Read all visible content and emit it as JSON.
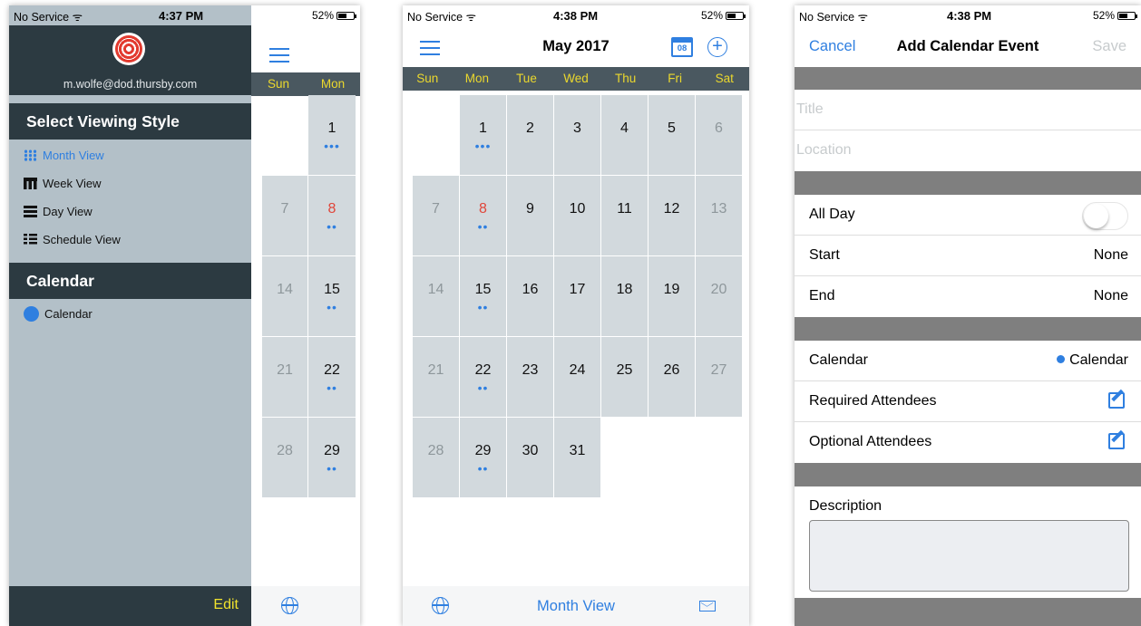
{
  "phone1": {
    "status": {
      "carrier": "No Service",
      "time": "4:37 PM",
      "battery": "52%"
    },
    "email": "m.wolfe@dod.thursby.com",
    "viewing_section": "Select Viewing Style",
    "views": [
      {
        "label": "Month View",
        "icon": "grid-icon",
        "active": true
      },
      {
        "label": "Week View",
        "icon": "week-icon",
        "active": false
      },
      {
        "label": "Day View",
        "icon": "day-icon",
        "active": false
      },
      {
        "label": "Schedule View",
        "icon": "schedule-icon",
        "active": false
      }
    ],
    "calendar_section": "Calendar",
    "calendar_item": "Calendar",
    "edit": "Edit",
    "days": [
      "Sun",
      "Mon"
    ],
    "cells": [
      {
        "sun": "",
        "mon": "1",
        "mon_dots": "•••"
      },
      {
        "sun": "7",
        "mon": "8",
        "mon_dots": "••"
      },
      {
        "sun": "14",
        "mon": "15",
        "mon_dots": "••"
      },
      {
        "sun": "21",
        "mon": "22",
        "mon_dots": "••"
      },
      {
        "sun": "28",
        "mon": "29",
        "mon_dots": "••"
      }
    ]
  },
  "phone2": {
    "status": {
      "carrier": "No Service",
      "time": "4:38 PM",
      "battery": "52%"
    },
    "title": "May 2017",
    "cal_icon_day": "08",
    "days": [
      "Sun",
      "Mon",
      "Tue",
      "Wed",
      "Thu",
      "Fri",
      "Sat"
    ],
    "weeks": [
      [
        "",
        "1",
        "2",
        "3",
        "4",
        "5",
        "6"
      ],
      [
        "7",
        "8",
        "9",
        "10",
        "11",
        "12",
        "13"
      ],
      [
        "14",
        "15",
        "16",
        "17",
        "18",
        "19",
        "20"
      ],
      [
        "21",
        "22",
        "23",
        "24",
        "25",
        "26",
        "27"
      ],
      [
        "28",
        "29",
        "30",
        "31",
        "",
        "",
        ""
      ]
    ],
    "dots": {
      "1": "•••",
      "8": "••",
      "15": "••",
      "22": "••",
      "29": "••"
    },
    "bottom_label": "Month View"
  },
  "phone3": {
    "status": {
      "carrier": "No Service",
      "time": "4:38 PM",
      "battery": "52%"
    },
    "cancel": "Cancel",
    "title": "Add Calendar Event",
    "save": "Save",
    "title_placeholder": "Title",
    "location_placeholder": "Location",
    "all_day": "All Day",
    "start": "Start",
    "start_value": "None",
    "end": "End",
    "end_value": "None",
    "calendar": "Calendar",
    "calendar_value": "Calendar",
    "required": "Required Attendees",
    "optional": "Optional Attendees",
    "description": "Description"
  },
  "colors": {
    "accent": "#2f7fe0",
    "header_dark": "#2c3a41",
    "weekday_yellow": "#ebd82d",
    "cell_gray": "#d2d9dd"
  }
}
